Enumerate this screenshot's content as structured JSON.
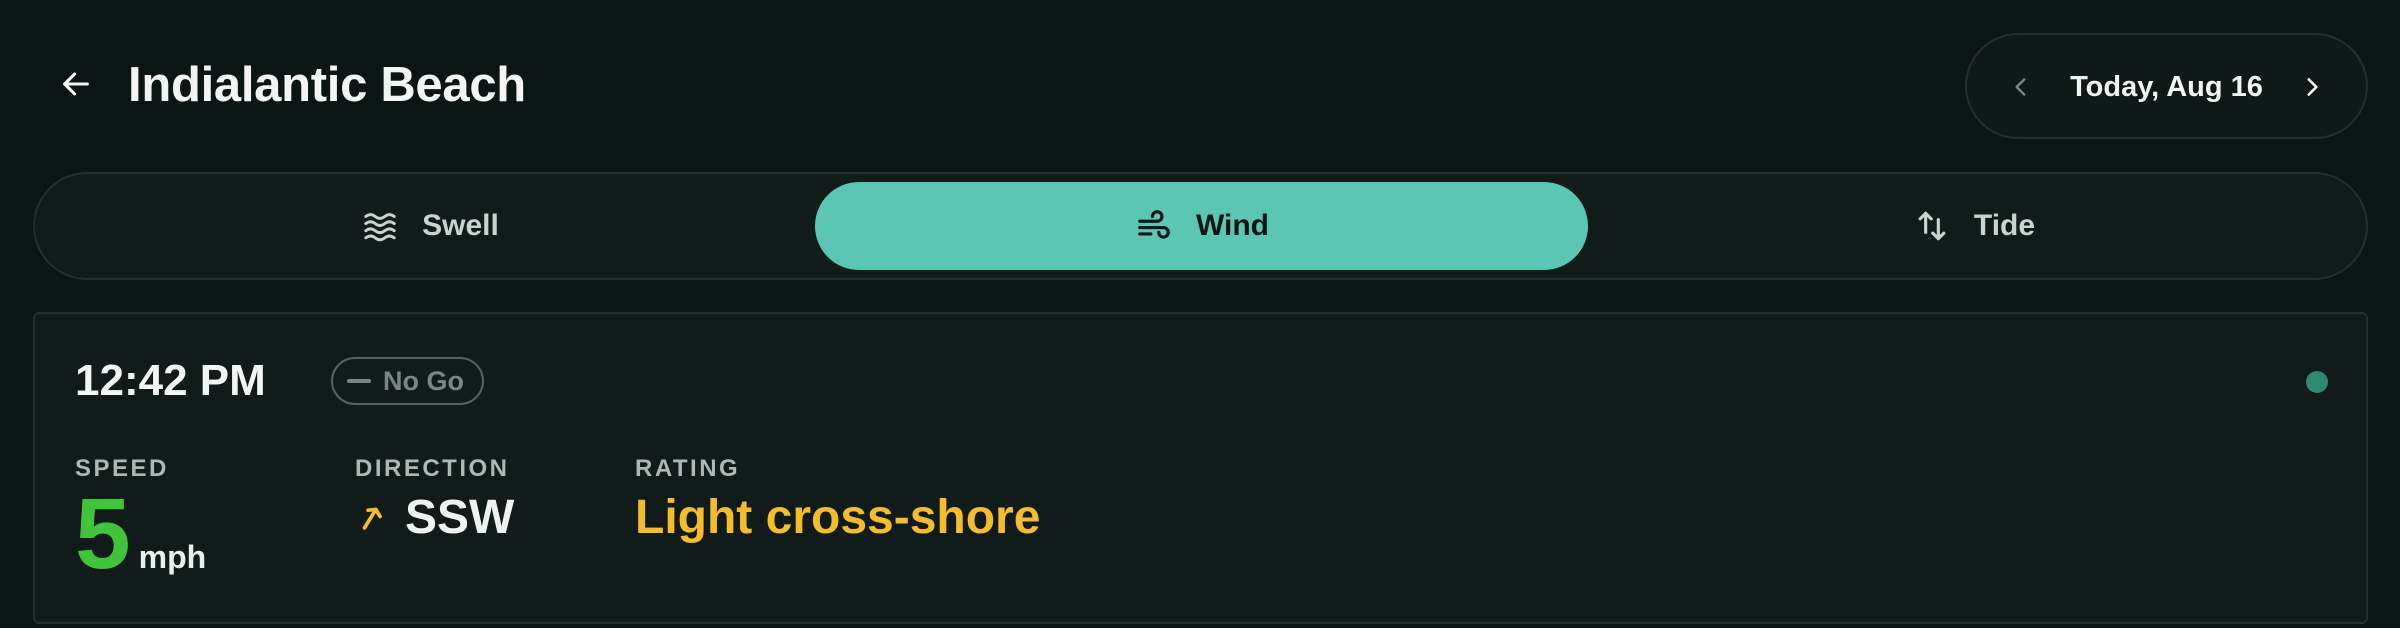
{
  "header": {
    "title": "Indialantic Beach",
    "back_icon": "arrow-left-icon"
  },
  "date_nav": {
    "label": "Today, Aug 16",
    "prev_icon": "chevron-left-icon",
    "next_icon": "chevron-right-icon"
  },
  "tabs": [
    {
      "label": "Swell",
      "icon": "waves-icon",
      "active": false
    },
    {
      "label": "Wind",
      "icon": "wind-icon",
      "active": true
    },
    {
      "label": "Tide",
      "icon": "swap-vertical-icon",
      "active": false
    }
  ],
  "card": {
    "time": "12:42 PM",
    "status": "No Go",
    "speed": {
      "label": "SPEED",
      "value": "5",
      "unit": "mph"
    },
    "direction": {
      "label": "DIRECTION",
      "value": "SSW",
      "icon": "arrow-up-right-icon"
    },
    "rating": {
      "label": "RATING",
      "value": "Light cross-shore"
    }
  },
  "colors": {
    "background": "#0b1514",
    "accent": "#5cc6b5",
    "speed": "#3fc43b",
    "rating": "#f6bd2b",
    "live_dot": "#2f8a74"
  }
}
